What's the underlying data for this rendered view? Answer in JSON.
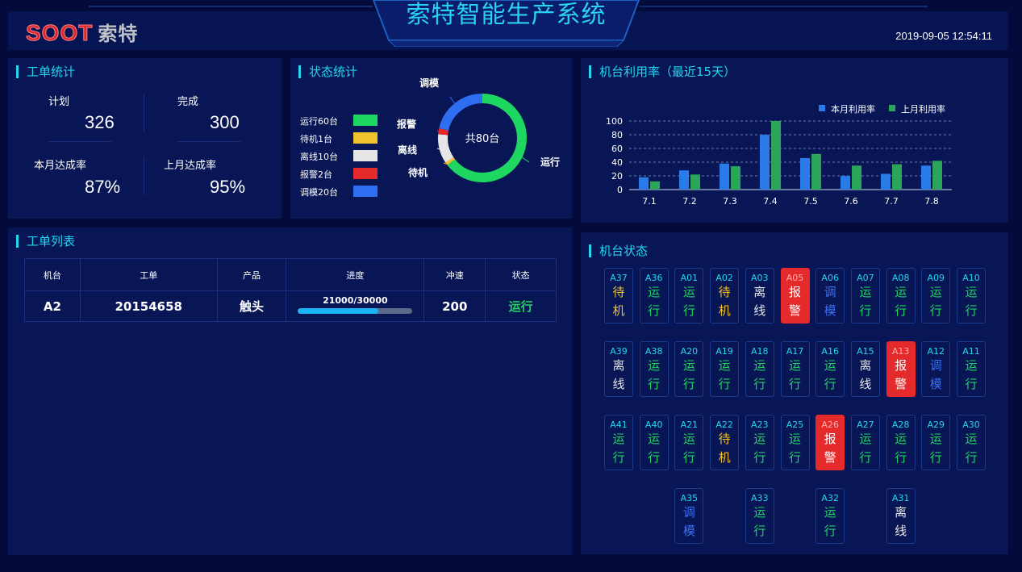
{
  "header": {
    "logo_en": "SOOT",
    "logo_cn": "索特",
    "title": "索特智能生产系统",
    "datetime": "2019-09-05 12:54:11"
  },
  "work_stats": {
    "title": "工单统计",
    "plan_label": "计划",
    "plan_value": "326",
    "done_label": "完成",
    "done_value": "300",
    "month_rate_label": "本月达成率",
    "month_rate_value": "87%",
    "last_month_rate_label": "上月达成率",
    "last_month_rate_value": "95%"
  },
  "status_stats": {
    "title": "状态统计",
    "center_label": "共80台",
    "legend": [
      {
        "label": "运行60台",
        "color": "#1ed760"
      },
      {
        "label": "待机1台",
        "color": "#f2c12e"
      },
      {
        "label": "离线10台",
        "color": "#e6e6e6"
      },
      {
        "label": "报警2台",
        "color": "#e42a2a"
      },
      {
        "label": "调模20台",
        "color": "#2d6ff0"
      }
    ],
    "slice_labels": {
      "run": "运行",
      "idle": "待机",
      "off": "离线",
      "alarm": "报警",
      "mold": "调模"
    }
  },
  "utilization": {
    "title": "机台利用率（最近15天）"
  },
  "chart_data": {
    "type": "bar",
    "categories": [
      "7.1",
      "7.2",
      "7.3",
      "7.4",
      "7.5",
      "7.6",
      "7.7",
      "7.8"
    ],
    "series": [
      {
        "name": "本月利用率",
        "color": "#2a7ae8",
        "values": [
          18,
          28,
          38,
          80,
          46,
          20,
          23,
          35
        ]
      },
      {
        "name": "上月利用率",
        "color": "#2ba55a",
        "values": [
          12,
          22,
          34,
          100,
          52,
          35,
          37,
          42
        ]
      }
    ],
    "yticks": [
      "0",
      "20",
      "40",
      "60",
      "80",
      "100"
    ],
    "ylim": [
      0,
      100
    ],
    "legend_position": "top-right",
    "grid": true
  },
  "work_list": {
    "title": "工单列表",
    "headers": [
      "机台",
      "工单",
      "产品",
      "进度",
      "冲速",
      "状态"
    ],
    "rows": [
      {
        "machine": "A2",
        "order": "20154658",
        "product": "触头",
        "progress_text": "21000/30000",
        "progress_fraction": 0.7,
        "speed": "200",
        "status": "运行"
      }
    ]
  },
  "machine_status": {
    "title": "机台状态",
    "rows": [
      [
        {
          "id": "A37",
          "status": "待机",
          "type": "idle"
        },
        {
          "id": "A36",
          "status": "运行",
          "type": "run"
        },
        {
          "id": "A01",
          "status": "运行",
          "type": "run"
        },
        {
          "id": "A02",
          "status": "待机",
          "type": "idle"
        },
        {
          "id": "A03",
          "status": "离线",
          "type": "off"
        },
        {
          "id": "A05",
          "status": "报警",
          "type": "alarm"
        },
        {
          "id": "A06",
          "status": "调模",
          "type": "mold"
        },
        {
          "id": "A07",
          "status": "运行",
          "type": "run"
        },
        {
          "id": "A08",
          "status": "运行",
          "type": "run"
        },
        {
          "id": "A09",
          "status": "运行",
          "type": "run"
        },
        {
          "id": "A10",
          "status": "运行",
          "type": "run"
        }
      ],
      [
        {
          "id": "A39",
          "status": "离线",
          "type": "off"
        },
        {
          "id": "A38",
          "status": "运行",
          "type": "run"
        },
        {
          "id": "A20",
          "status": "运行",
          "type": "run"
        },
        {
          "id": "A19",
          "status": "运行",
          "type": "run"
        },
        {
          "id": "A18",
          "status": "运行",
          "type": "run"
        },
        {
          "id": "A17",
          "status": "运行",
          "type": "run"
        },
        {
          "id": "A16",
          "status": "运行",
          "type": "run"
        },
        {
          "id": "A15",
          "status": "离线",
          "type": "off"
        },
        {
          "id": "A13",
          "status": "报警",
          "type": "alarm"
        },
        {
          "id": "A12",
          "status": "调模",
          "type": "mold"
        },
        {
          "id": "A11",
          "status": "运行",
          "type": "run"
        }
      ],
      [
        {
          "id": "A41",
          "status": "运行",
          "type": "run"
        },
        {
          "id": "A40",
          "status": "运行",
          "type": "run"
        },
        {
          "id": "A21",
          "status": "运行",
          "type": "run"
        },
        {
          "id": "A22",
          "status": "待机",
          "type": "idle"
        },
        {
          "id": "A23",
          "status": "运行",
          "type": "run"
        },
        {
          "id": "A25",
          "status": "运行",
          "type": "run"
        },
        {
          "id": "A26",
          "status": "报警",
          "type": "alarm"
        },
        {
          "id": "A27",
          "status": "运行",
          "type": "run"
        },
        {
          "id": "A28",
          "status": "运行",
          "type": "run"
        },
        {
          "id": "A29",
          "status": "运行",
          "type": "run"
        },
        {
          "id": "A30",
          "status": "运行",
          "type": "run"
        }
      ],
      [
        {
          "id": "A35",
          "status": "调模",
          "type": "mold",
          "col": 2
        },
        {
          "id": "A33",
          "status": "运行",
          "type": "run",
          "col": 4
        },
        {
          "id": "A32",
          "status": "运行",
          "type": "run",
          "col": 6
        },
        {
          "id": "A31",
          "status": "离线",
          "type": "off",
          "col": 8
        }
      ]
    ]
  }
}
